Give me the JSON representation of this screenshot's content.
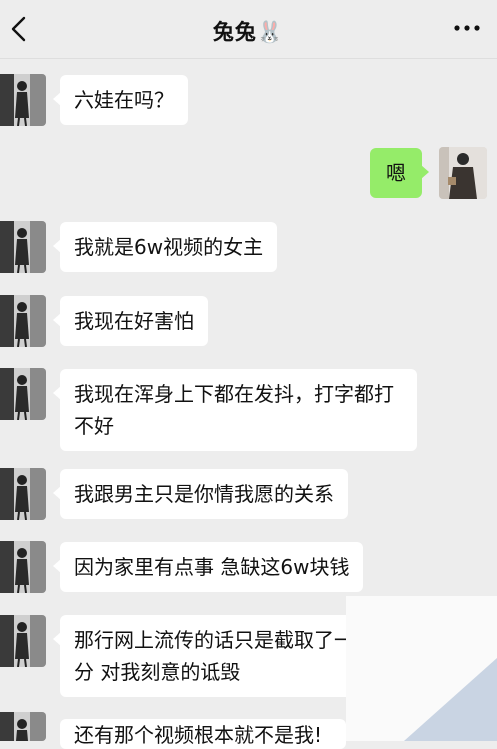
{
  "header": {
    "title": "兔兔🐰"
  },
  "messages": [
    {
      "from": "other",
      "text": "六娃在吗？"
    },
    {
      "from": "me",
      "text": "嗯"
    },
    {
      "from": "other",
      "text": "我就是6w视频的女主"
    },
    {
      "from": "other",
      "text": "我现在好害怕"
    },
    {
      "from": "other",
      "text": "我现在浑身上下都在发抖，打字都打不好"
    },
    {
      "from": "other",
      "text": "我跟男主只是你情我愿的关系"
    },
    {
      "from": "other",
      "text": "因为家里有点事 急缺这6w块钱"
    },
    {
      "from": "other",
      "text": "那行网上流传的话只是截取了一部分 对我刻意的诋毁"
    },
    {
      "from": "other",
      "text": "还有那个视频根本就不是我!"
    }
  ],
  "colors": {
    "background": "#ededed",
    "bubble_other": "#ffffff",
    "bubble_me": "#95ec69"
  },
  "icons": [
    "back-icon",
    "more-icon",
    "rabbit-emoji"
  ]
}
